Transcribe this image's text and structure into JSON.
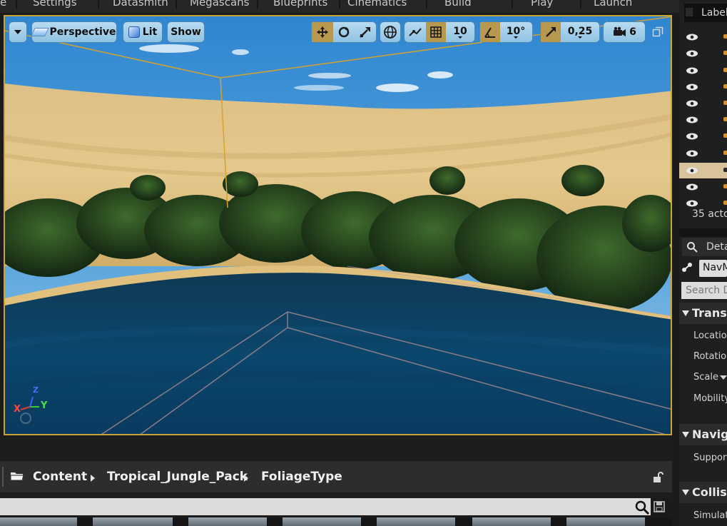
{
  "menu": {
    "items": [
      "e",
      "Settings",
      "Datasmith",
      "Megascans",
      "Blueprints",
      "Cinematics",
      "Build",
      "Play",
      "Launch"
    ]
  },
  "viewport": {
    "perspective_label": "Perspective",
    "lit_label": "Lit",
    "show_label": "Show",
    "grid_snap_value": "10",
    "rotation_snap_value": "10°",
    "scale_snap_value": "0,25",
    "camera_speed_value": "6",
    "axis_x": "X",
    "axis_y": "Y",
    "axis_z": "Z"
  },
  "outliner": {
    "header_label": "Label",
    "actor_count_text": "35 acto"
  },
  "details": {
    "tab_label": "Deta",
    "selected_actor": "NavM",
    "search_placeholder": "Search D",
    "sections": {
      "transform": "Transf",
      "navigation": "Naviga",
      "collision": "Collisi"
    },
    "rows": {
      "location": "Location",
      "rotation": "Rotation",
      "scale": "Scale",
      "mobility": "Mobility",
      "supported": "Support",
      "simulation": "Simulati"
    }
  },
  "content_browser": {
    "breadcrumb": [
      "Content",
      "Tropical_Jungle_Pack",
      "FoliageType"
    ]
  }
}
